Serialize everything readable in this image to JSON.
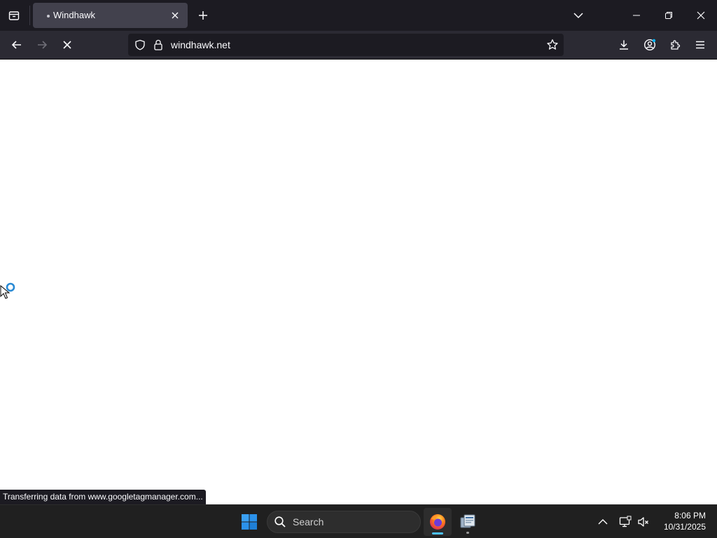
{
  "browser": {
    "tab": {
      "title": "Windhawk"
    },
    "url": "windhawk.net",
    "status_text": "Transferring data from www.googletagmanager.com..."
  },
  "taskbar": {
    "search_placeholder": "Search",
    "clock": {
      "time": "8:06 PM",
      "date": "10/31/2025"
    }
  },
  "colors": {
    "tabstrip_bg": "#1c1b22",
    "toolbar_bg": "#2b2a33",
    "active_tab_bg": "#42414d",
    "taskbar_bg": "#202020",
    "accent": "#4cc2ff"
  }
}
